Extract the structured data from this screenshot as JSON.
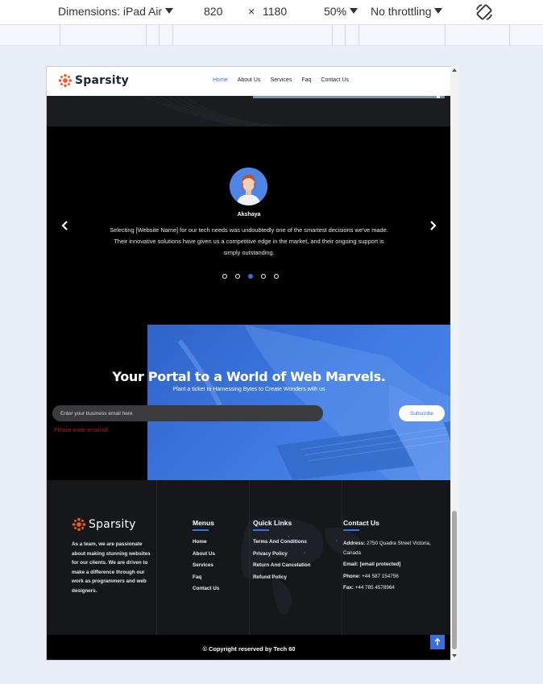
{
  "devtools": {
    "dimensions_label": "Dimensions: iPad Air",
    "width": "820",
    "times": "×",
    "height": "1180",
    "zoom": "50%",
    "throttling": "No throttling"
  },
  "site": {
    "brand": "Sparsity",
    "accent_color": "#3a6fd8",
    "logo_color": "#f05a28",
    "nav": [
      {
        "label": "Home",
        "active": true
      },
      {
        "label": "About Us",
        "active": false
      },
      {
        "label": "Services",
        "active": false
      },
      {
        "label": "Faq",
        "active": false
      },
      {
        "label": "Contact Us",
        "active": false
      }
    ]
  },
  "testimonial": {
    "name": "Akshaya",
    "quote": "Selecting [Website Name] for our tech needs was undoubtedly one of the smartest decisions we've made. Their innovative solutions have given us a competitive edge in the market, and their ongoing support is simply outstanding.",
    "prev_icon": "chevron-left-icon",
    "next_icon": "chevron-right-icon",
    "dot_count": 5,
    "active_dot": 3
  },
  "newsletter": {
    "title": "Your Portal to a World of Web Marvels.",
    "subtitle": "Plant a ticket to Harnessing Bytes to Create Wonders with us",
    "placeholder": "Enter your business email here",
    "button": "Subscribe",
    "error": "Please enter email id!"
  },
  "footer": {
    "brand": "Sparsity",
    "about": "As a team, we are passionate about making stunning websites for our clients. We are driven to make a difference through our work as programmers and web designers.",
    "menus": {
      "heading": "Menus",
      "items": [
        "Home",
        "About Us",
        "Services",
        "Faq",
        "Contact Us"
      ]
    },
    "quick_links": {
      "heading": "Quick Links",
      "items": [
        "Terms And Conditions",
        "Privacy Policy",
        "Return And Cancelation",
        "Refund Policy"
      ]
    },
    "contact": {
      "heading": "Contact Us",
      "address_label": "Address:",
      "address": "2750 Quadra Street Victoria, Canada",
      "email_label": "Email:",
      "email": "[email protected]",
      "phone_label": "Phone:",
      "phone": "+44 587 154756",
      "fax_label": "Fax:",
      "fax": "+44 785 4578964"
    },
    "copyright": "© Copyright reserved by Tech 60",
    "to_top_icon": "arrow-up-icon"
  }
}
